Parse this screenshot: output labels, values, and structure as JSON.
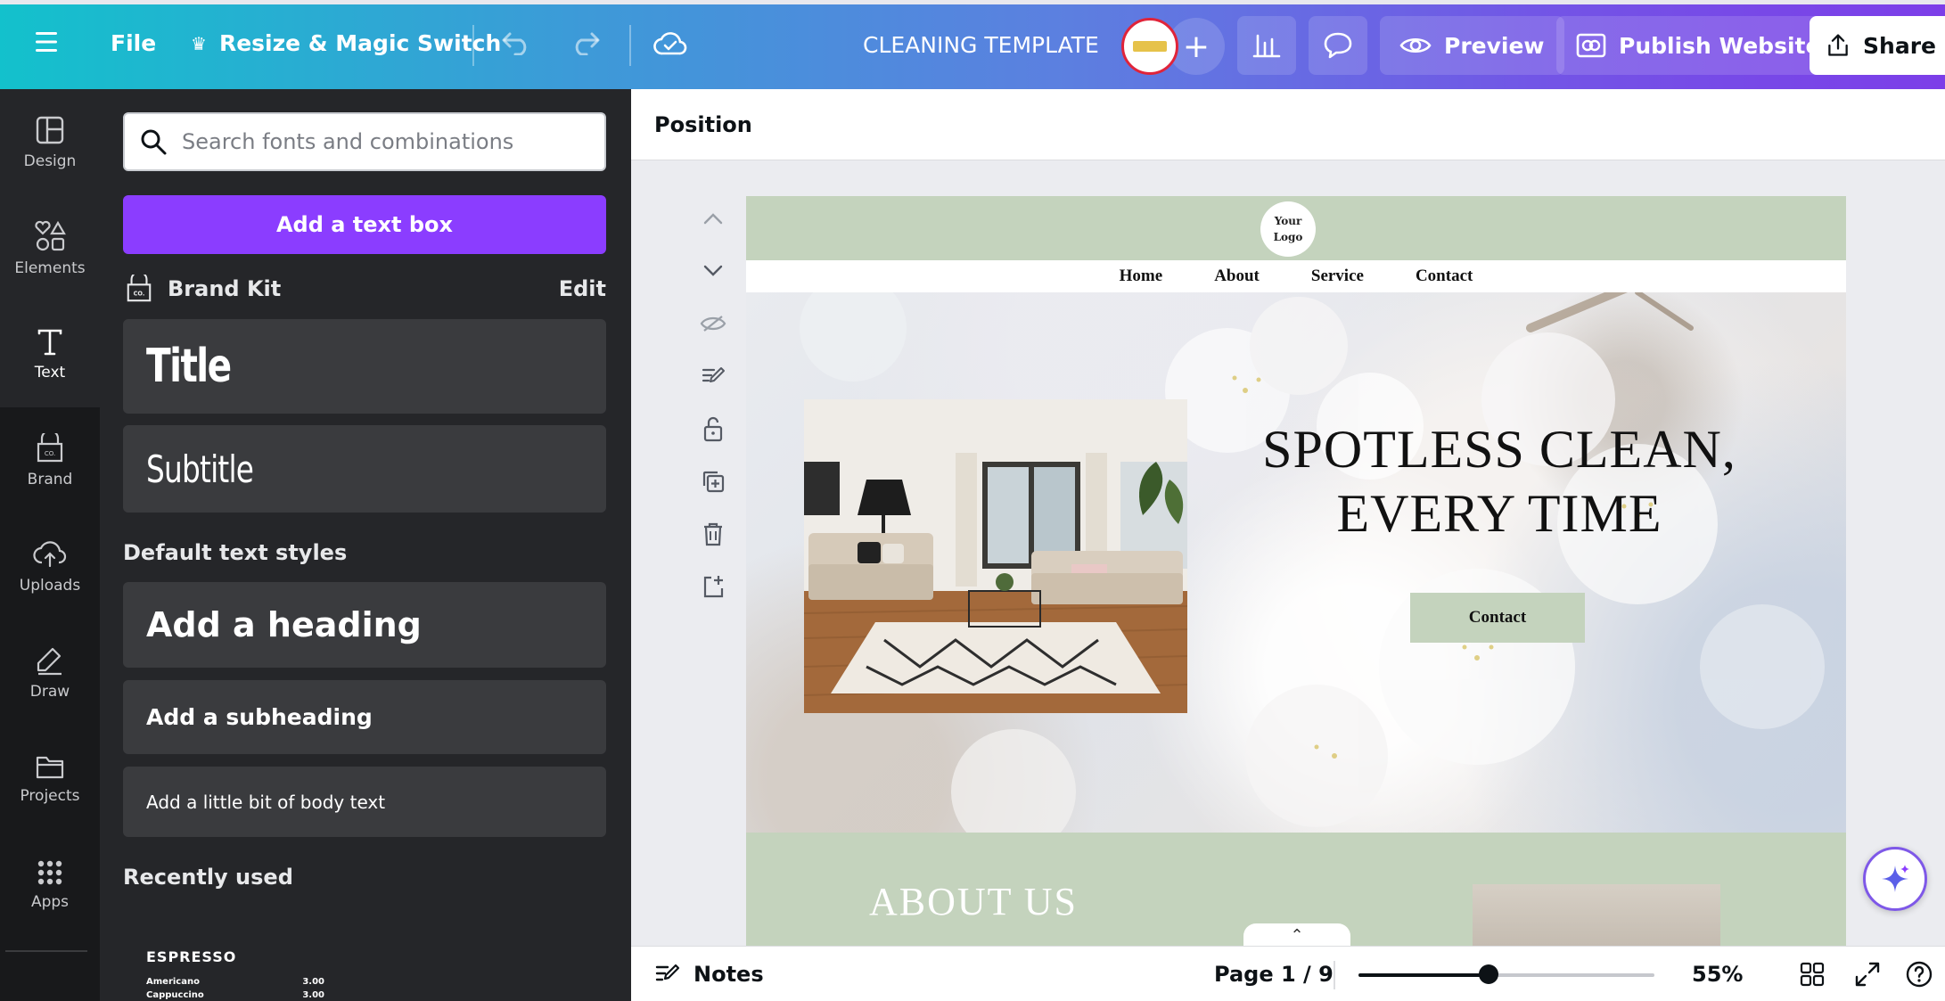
{
  "topbar": {
    "file_label": "File",
    "resize_label": "Resize & Magic Switch",
    "doc_title": "CLEANING TEMPLATE",
    "preview_label": "Preview",
    "publish_label": "Publish Website",
    "share_label": "Share"
  },
  "rail": {
    "items": [
      {
        "label": "Design",
        "icon": "design-icon"
      },
      {
        "label": "Elements",
        "icon": "elements-icon"
      },
      {
        "label": "Text",
        "icon": "text-icon"
      },
      {
        "label": "Brand",
        "icon": "brand-icon"
      },
      {
        "label": "Uploads",
        "icon": "uploads-icon"
      },
      {
        "label": "Draw",
        "icon": "draw-icon"
      },
      {
        "label": "Projects",
        "icon": "projects-icon"
      },
      {
        "label": "Apps",
        "icon": "apps-icon"
      }
    ]
  },
  "panel": {
    "search_placeholder": "Search fonts and combinations",
    "add_text_box": "Add a text box",
    "brand_kit": "Brand Kit",
    "edit": "Edit",
    "title_style": "Title",
    "subtitle_style": "Subtitle",
    "default_styles_heading": "Default text styles",
    "add_heading": "Add a heading",
    "add_subheading": "Add a subheading",
    "add_body": "Add a little bit of body text",
    "recently_used": "Recently used",
    "recent_sample": {
      "heading": "ESPRESSO",
      "rows": [
        {
          "name": "Americano",
          "price": "3.00"
        },
        {
          "name": "Cappuccino",
          "price": "3.00"
        }
      ]
    }
  },
  "editor": {
    "position_label": "Position"
  },
  "page": {
    "logo_line1": "Your",
    "logo_line2": "Logo",
    "nav": [
      "Home",
      "About",
      "Service",
      "Contact"
    ],
    "headline_line1": "SPOTLESS CLEAN,",
    "headline_line2": "EVERY TIME",
    "contact_button": "Contact",
    "about_title": "ABOUT US",
    "brand_color": "#c4d3bd"
  },
  "bottombar": {
    "notes_label": "Notes",
    "page_indicator": "Page 1 / 9",
    "zoom": "55%",
    "zoom_fraction": 0.44
  }
}
